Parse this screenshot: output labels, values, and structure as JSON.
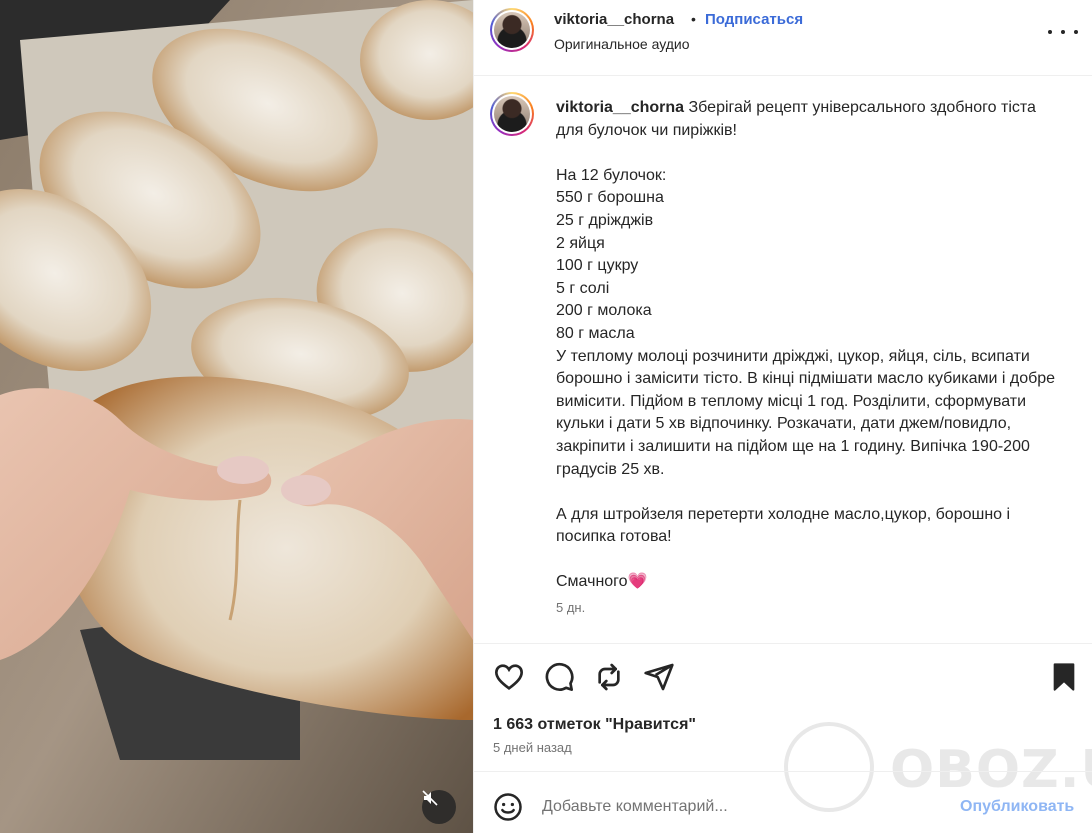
{
  "post": {
    "username": "viktoria__chorna",
    "separator": "•",
    "follow_label": "Подписаться",
    "audio_label": "Оригинальное аудио",
    "more_icon": "more-horizontal-icon"
  },
  "caption": {
    "username": "viktoria__chorna",
    "text": "Зберігай рецепт універсального здобного тіста для булочок чи пиріжків!\n\nНа 12 булочок:\n550 г борошна\n25 г дріжджів\n2 яйця\n100 г цукру\n5 г солі\n200 г молока\n80 г масла\nУ теплому молоці розчинити дріжджі, цукор, яйця, сіль, всипати борошно і замісити тісто. В кінці підмішати масло кубиками і добре вимісити. Підйом в теплому місці 1 год. Розділити, сформувати кульки і дати 5 хв відпочинку. Розкачати, дати джем/повидло, закріпити і залишити на підйом ще на 1 годину. Випічка 190-200 градусів 25 хв.\n\nА для штройзеля перетерти холодне масло,цукор, борошно і посипка готова!\n\nСмачного",
    "emoji": "💗",
    "time": "5 дн."
  },
  "actions": {
    "likes": "1 663 отметок \"Нравится\"",
    "date": "5 дней назад",
    "icons": [
      "heart-icon",
      "comment-icon",
      "repost-icon",
      "share-icon",
      "bookmark-icon"
    ]
  },
  "comment": {
    "placeholder": "Добавьте комментарий...",
    "publish_label": "Опубликовать"
  },
  "watermark": {
    "text": "OBOZ.UA"
  },
  "media": {
    "mute_icon": "volume-muted-icon"
  },
  "colors": {
    "link_blue": "#3b6bd8",
    "publish_blue": "#8fb6f4",
    "text": "#262626",
    "muted": "#737373"
  }
}
